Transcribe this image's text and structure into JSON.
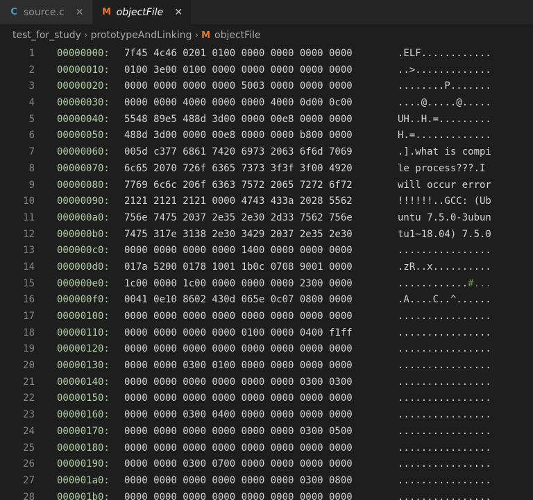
{
  "tabs": [
    {
      "icon": "C",
      "label": "source.c",
      "close": "✕",
      "active": false
    },
    {
      "icon": "M",
      "label": "objectFile",
      "close": "✕",
      "active": true
    }
  ],
  "breadcrumb": {
    "parts": [
      "test_for_study",
      "prototypeAndLinking",
      "objectFile"
    ],
    "sep": "›",
    "file_icon": "M"
  },
  "hexdump": [
    {
      "ln": "1",
      "addr": "00000000:",
      "hex": "7f45 4c46 0201 0100 0000 0000 0000 0000",
      "ascii": ".ELF............"
    },
    {
      "ln": "2",
      "addr": "00000010:",
      "hex": "0100 3e00 0100 0000 0000 0000 0000 0000",
      "ascii": "..>............."
    },
    {
      "ln": "3",
      "addr": "00000020:",
      "hex": "0000 0000 0000 0000 5003 0000 0000 0000",
      "ascii": "........P......."
    },
    {
      "ln": "4",
      "addr": "00000030:",
      "hex": "0000 0000 4000 0000 0000 4000 0d00 0c00",
      "ascii": "....@.....@....."
    },
    {
      "ln": "5",
      "addr": "00000040:",
      "hex": "5548 89e5 488d 3d00 0000 00e8 0000 0000",
      "ascii": "UH..H.=........."
    },
    {
      "ln": "6",
      "addr": "00000050:",
      "hex": "488d 3d00 0000 00e8 0000 0000 b800 0000",
      "ascii": "H.=............."
    },
    {
      "ln": "7",
      "addr": "00000060:",
      "hex": "005d c377 6861 7420 6973 2063 6f6d 7069",
      "ascii": ".].what is compi"
    },
    {
      "ln": "8",
      "addr": "00000070:",
      "hex": "6c65 2070 726f 6365 7373 3f3f 3f00 4920",
      "ascii": "le process???.I "
    },
    {
      "ln": "9",
      "addr": "00000080:",
      "hex": "7769 6c6c 206f 6363 7572 2065 7272 6f72",
      "ascii": "will occur error"
    },
    {
      "ln": "10",
      "addr": "00000090:",
      "hex": "2121 2121 2121 0000 4743 433a 2028 5562",
      "ascii": "!!!!!!..GCC: (Ub"
    },
    {
      "ln": "11",
      "addr": "000000a0:",
      "hex": "756e 7475 2037 2e35 2e30 2d33 7562 756e",
      "ascii": "untu 7.5.0-3ubun"
    },
    {
      "ln": "12",
      "addr": "000000b0:",
      "hex": "7475 317e 3138 2e30 3429 2037 2e35 2e30",
      "ascii": "tu1~18.04) 7.5.0"
    },
    {
      "ln": "13",
      "addr": "000000c0:",
      "hex": "0000 0000 0000 0000 1400 0000 0000 0000",
      "ascii": "................"
    },
    {
      "ln": "14",
      "addr": "000000d0:",
      "hex": "017a 5200 0178 1001 1b0c 0708 9001 0000",
      "ascii": ".zR..x.........."
    },
    {
      "ln": "15",
      "addr": "000000e0:",
      "hex": "1c00 0000 1c00 0000 0000 0000 2300 0000",
      "ascii": "............",
      "ascii_hl": "#...",
      "ascii_hl_note": "highlighted"
    },
    {
      "ln": "16",
      "addr": "000000f0:",
      "hex": "0041 0e10 8602 430d 065e 0c07 0800 0000",
      "ascii": ".A....C..^......"
    },
    {
      "ln": "17",
      "addr": "00000100:",
      "hex": "0000 0000 0000 0000 0000 0000 0000 0000",
      "ascii": "................"
    },
    {
      "ln": "18",
      "addr": "00000110:",
      "hex": "0000 0000 0000 0000 0100 0000 0400 f1ff",
      "ascii": "................"
    },
    {
      "ln": "19",
      "addr": "00000120:",
      "hex": "0000 0000 0000 0000 0000 0000 0000 0000",
      "ascii": "................"
    },
    {
      "ln": "20",
      "addr": "00000130:",
      "hex": "0000 0000 0300 0100 0000 0000 0000 0000",
      "ascii": "................"
    },
    {
      "ln": "21",
      "addr": "00000140:",
      "hex": "0000 0000 0000 0000 0000 0000 0300 0300",
      "ascii": "................"
    },
    {
      "ln": "22",
      "addr": "00000150:",
      "hex": "0000 0000 0000 0000 0000 0000 0000 0000",
      "ascii": "................"
    },
    {
      "ln": "23",
      "addr": "00000160:",
      "hex": "0000 0000 0300 0400 0000 0000 0000 0000",
      "ascii": "................"
    },
    {
      "ln": "24",
      "addr": "00000170:",
      "hex": "0000 0000 0000 0000 0000 0000 0300 0500",
      "ascii": "................"
    },
    {
      "ln": "25",
      "addr": "00000180:",
      "hex": "0000 0000 0000 0000 0000 0000 0000 0000",
      "ascii": "................"
    },
    {
      "ln": "26",
      "addr": "00000190:",
      "hex": "0000 0000 0300 0700 0000 0000 0000 0000",
      "ascii": "................"
    },
    {
      "ln": "27",
      "addr": "000001a0:",
      "hex": "0000 0000 0000 0000 0000 0000 0300 0800",
      "ascii": "................"
    },
    {
      "ln": "28",
      "addr": "000001b0:",
      "hex": "0000 0000 0000 0000 0000 0000 0000 0000",
      "ascii": "................"
    }
  ],
  "colors": {
    "background": "#1e1e1e",
    "address": "#b5cea8",
    "c_icon": "#519aba",
    "m_icon": "#e37933"
  }
}
